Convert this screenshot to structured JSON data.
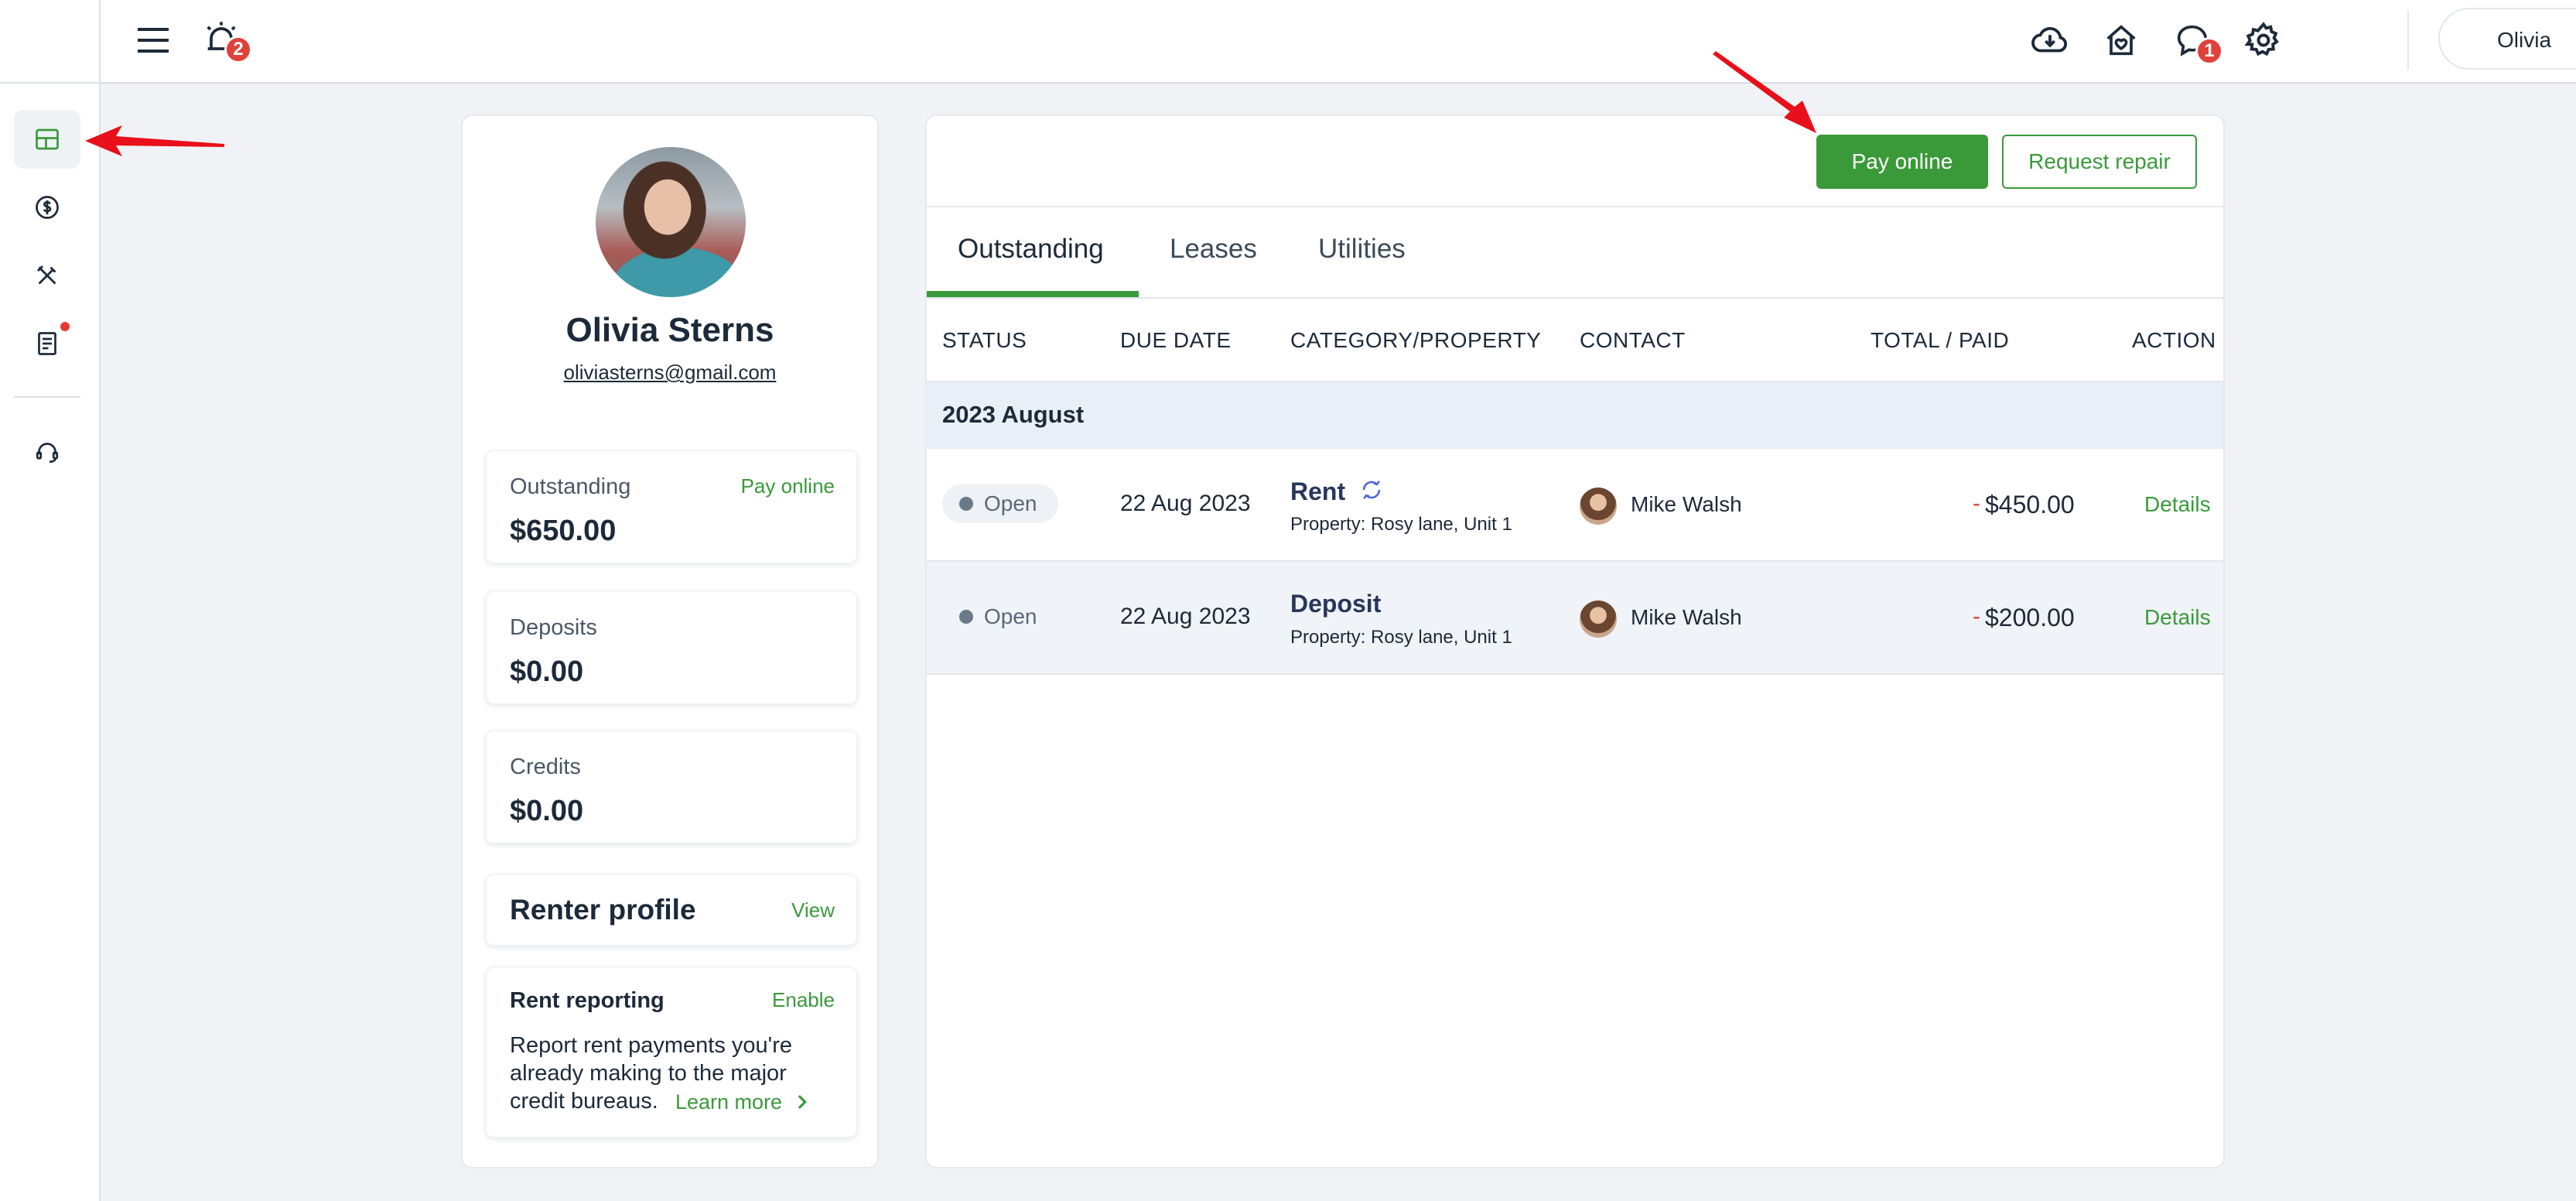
{
  "topbar": {
    "menu_icon": "hamburger-icon",
    "alarm_badge": "2",
    "chat_badge": "1",
    "user_name": "Olivia"
  },
  "sidebar": {
    "items": [
      {
        "icon": "dashboard-icon",
        "active": true
      },
      {
        "icon": "dollar-icon",
        "active": false
      },
      {
        "icon": "tools-icon",
        "active": false
      },
      {
        "icon": "document-icon",
        "active": false,
        "dot": true
      },
      {
        "icon": "support-headset-icon",
        "active": false
      }
    ]
  },
  "profile": {
    "name": "Olivia Sterns",
    "email": "oliviasterns@gmail.com",
    "outstanding": {
      "label": "Outstanding",
      "value": "$650.00",
      "link": "Pay online"
    },
    "deposits": {
      "label": "Deposits",
      "value": "$0.00"
    },
    "credits": {
      "label": "Credits",
      "value": "$0.00"
    },
    "renter_profile": {
      "label": "Renter profile",
      "link": "View"
    },
    "rent_reporting": {
      "label": "Rent reporting",
      "link": "Enable",
      "line1": "Report rent payments you're",
      "line2": "already making to the major",
      "line3": "credit bureaus.",
      "learn_more": "Learn more"
    }
  },
  "main": {
    "pay_online": "Pay online",
    "request_repair": "Request repair",
    "tabs": [
      "Outstanding",
      "Leases",
      "Utilities"
    ],
    "columns": [
      "STATUS",
      "DUE DATE",
      "CATEGORY/PROPERTY",
      "CONTACT",
      "TOTAL / PAID",
      "ACTION"
    ],
    "group": "2023 August",
    "rows": [
      {
        "status": "Open",
        "due": "22 Aug 2023",
        "category": "Rent",
        "property": "Property: Rosy lane, Unit 1",
        "contact": "Mike Walsh",
        "minus": "-",
        "amount": "$450.00",
        "action": "Details"
      },
      {
        "status": "Open",
        "due": "22 Aug 2023",
        "category": "Deposit",
        "property": "Property: Rosy lane, Unit 1",
        "contact": "Mike Walsh",
        "minus": "-",
        "amount": "$200.00",
        "action": "Details"
      }
    ]
  },
  "colors": {
    "accent_green": "#3a9a3a",
    "badge_red": "#e0413b",
    "annotation_red": "#e8101a"
  }
}
